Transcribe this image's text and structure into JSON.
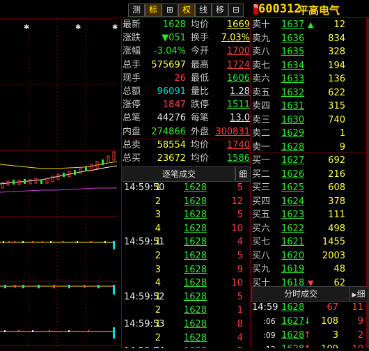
{
  "toolbar": {
    "buttons": [
      "测",
      "标",
      "⊞",
      "权",
      "线",
      "移",
      "⊟",
      "⊠"
    ],
    "active_index": [
      1,
      3
    ],
    "code": "600312",
    "name": "平高电气",
    "badge": "融"
  },
  "quote_left": [
    {
      "label": "最新",
      "value": "1628",
      "color": "grn"
    },
    {
      "label": "涨跌",
      "value": "▼051",
      "color": "grn"
    },
    {
      "label": "涨幅",
      "value": "-3.04%",
      "color": "grn"
    },
    {
      "label": "总手",
      "value": "575697",
      "color": "yel"
    },
    {
      "label": "现手",
      "value": "26",
      "color": "red"
    },
    {
      "label": "总额",
      "value": "96091",
      "color": "cyn"
    },
    {
      "label": "涨停",
      "value": "1847",
      "color": "red"
    },
    {
      "label": "总笔",
      "value": "44276",
      "color": "wht"
    },
    {
      "label": "内盘",
      "value": "274866",
      "color": "grn"
    },
    {
      "label": "总卖",
      "value": "58554",
      "color": "yel"
    },
    {
      "label": "总买",
      "value": "23672",
      "color": "yel"
    }
  ],
  "quote_mid": [
    {
      "label": "均价",
      "value": "1669",
      "color": "yel"
    },
    {
      "label": "换手",
      "value": "7.03%",
      "color": "yel"
    },
    {
      "label": "今开",
      "value": "1700",
      "color": "red"
    },
    {
      "label": "最高",
      "value": "1724",
      "color": "red"
    },
    {
      "label": "最低",
      "value": "1606",
      "color": "grn"
    },
    {
      "label": "量比",
      "value": "1.28",
      "color": "wht"
    },
    {
      "label": "跌停",
      "value": "1511",
      "color": "grn"
    },
    {
      "label": "每笔",
      "value": "13.0",
      "color": "wht"
    },
    {
      "label": "外盘",
      "value": "300831",
      "color": "red"
    },
    {
      "label": "均价",
      "value": "1740",
      "color": "red"
    },
    {
      "label": "均价",
      "value": "1586",
      "color": "grn"
    }
  ],
  "sell_levels": [
    {
      "label": "卖十",
      "price": "1637",
      "vol": "12",
      "arrow": "▲"
    },
    {
      "label": "卖九",
      "price": "1636",
      "vol": "834"
    },
    {
      "label": "卖八",
      "price": "1635",
      "vol": "328"
    },
    {
      "label": "卖七",
      "price": "1634",
      "vol": "194"
    },
    {
      "label": "卖六",
      "price": "1633",
      "vol": "136"
    },
    {
      "label": "卖五",
      "price": "1632",
      "vol": "622"
    },
    {
      "label": "卖四",
      "price": "1631",
      "vol": "315"
    },
    {
      "label": "卖三",
      "price": "1630",
      "vol": "740"
    },
    {
      "label": "卖二",
      "price": "1629",
      "vol": "1"
    },
    {
      "label": "卖一",
      "price": "1628",
      "vol": "9"
    }
  ],
  "buy_levels": [
    {
      "label": "买一",
      "price": "1627",
      "vol": "692"
    },
    {
      "label": "买二",
      "price": "1626",
      "vol": "216"
    },
    {
      "label": "买三",
      "price": "1625",
      "vol": "608"
    },
    {
      "label": "买四",
      "price": "1624",
      "vol": "378"
    },
    {
      "label": "买五",
      "price": "1623",
      "vol": "111"
    },
    {
      "label": "买六",
      "price": "1622",
      "vol": "498"
    },
    {
      "label": "买七",
      "price": "1621",
      "vol": "1455"
    },
    {
      "label": "买八",
      "price": "1620",
      "vol": "2003"
    },
    {
      "label": "买九",
      "price": "1619",
      "vol": "48"
    },
    {
      "label": "买十",
      "price": "1618",
      "vol": "62",
      "arrow": "▼"
    }
  ],
  "tick_panel": {
    "title": "逐笔成交",
    "button": "细",
    "rows": [
      {
        "time": "14:59:50",
        "vol": "1",
        "price": "1628",
        "count": "5"
      },
      {
        "time": "",
        "vol": "2",
        "price": "1628",
        "count": "12"
      },
      {
        "time": "",
        "vol": "3",
        "price": "1628",
        "count": "5"
      },
      {
        "time": "",
        "vol": "4",
        "price": "1628",
        "count": "10"
      },
      {
        "time": "14:59:51",
        "vol": "1",
        "price": "1628",
        "count": "4"
      },
      {
        "time": "",
        "vol": "2",
        "price": "1628",
        "count": "5"
      },
      {
        "time": "",
        "vol": "3",
        "price": "1628",
        "count": "9"
      },
      {
        "time": "",
        "vol": "4",
        "price": "1628",
        "count": "10"
      },
      {
        "time": "14:59:52",
        "vol": "1",
        "price": "1628",
        "count": "5"
      },
      {
        "time": "",
        "vol": "2",
        "price": "1628",
        "count": "1"
      },
      {
        "time": "14:59:53",
        "vol": "1",
        "price": "1628",
        "count": "8"
      },
      {
        "time": "",
        "vol": "2",
        "price": "1628",
        "count": "4"
      },
      {
        "time": "14:59:54",
        "vol": "1",
        "price": "1628",
        "count": "5"
      }
    ]
  },
  "minute_panel": {
    "title": "分时成交",
    "button": "细",
    "rows": [
      {
        "time": "14:59",
        "price": "1628",
        "vol": "67",
        "cnt": "11",
        "dir": ""
      },
      {
        "time": ":06",
        "price": "1627",
        "vol": "108",
        "cnt": "9",
        "dir": "↓"
      },
      {
        "time": ":09",
        "price": "1628",
        "vol": "3",
        "cnt": "2",
        "dir": "↑"
      },
      {
        "time": ":12",
        "price": "1628",
        "vol": "109",
        "cnt": "10",
        "dir": "↑"
      }
    ]
  },
  "colors": {
    "grid": "#7a0000",
    "up": "#ff4040",
    "down": "#2ee82e",
    "price": "#ffff40"
  }
}
